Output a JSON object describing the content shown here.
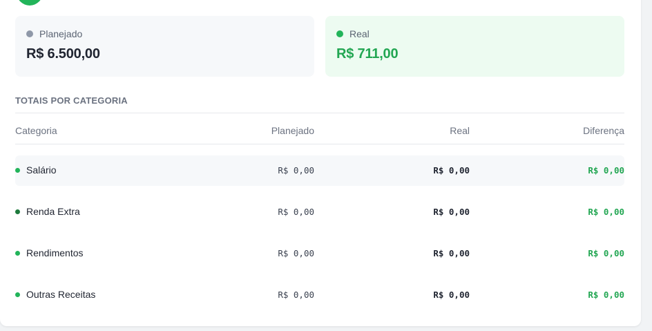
{
  "summary": {
    "planned": {
      "label": "Planejado",
      "value": "R$ 6.500,00",
      "dot_color": "#8f98a8"
    },
    "real": {
      "label": "Real",
      "value": "R$ 711,00",
      "dot_color": "#22b45a"
    }
  },
  "section_title": "TOTAIS POR CATEGORIA",
  "table": {
    "headers": {
      "category": "Categoria",
      "planned": "Planejado",
      "real": "Real",
      "difference": "Diferença"
    },
    "rows": [
      {
        "category": "Salário",
        "planned": "R$ 0,00",
        "real": "R$ 0,00",
        "difference": "R$ 0,00",
        "bullet_color": "#22b45a"
      },
      {
        "category": "Renda Extra",
        "planned": "R$ 0,00",
        "real": "R$ 0,00",
        "difference": "R$ 0,00",
        "bullet_color": "#1e7a3d"
      },
      {
        "category": "Rendimentos",
        "planned": "R$ 0,00",
        "real": "R$ 0,00",
        "difference": "R$ 0,00",
        "bullet_color": "#22b45a"
      },
      {
        "category": "Outras Receitas",
        "planned": "R$ 0,00",
        "real": "R$ 0,00",
        "difference": "R$ 0,00",
        "bullet_color": "#22b45a"
      }
    ]
  },
  "colors": {
    "accent_green": "#22a652",
    "brand_green": "#22b45a"
  }
}
